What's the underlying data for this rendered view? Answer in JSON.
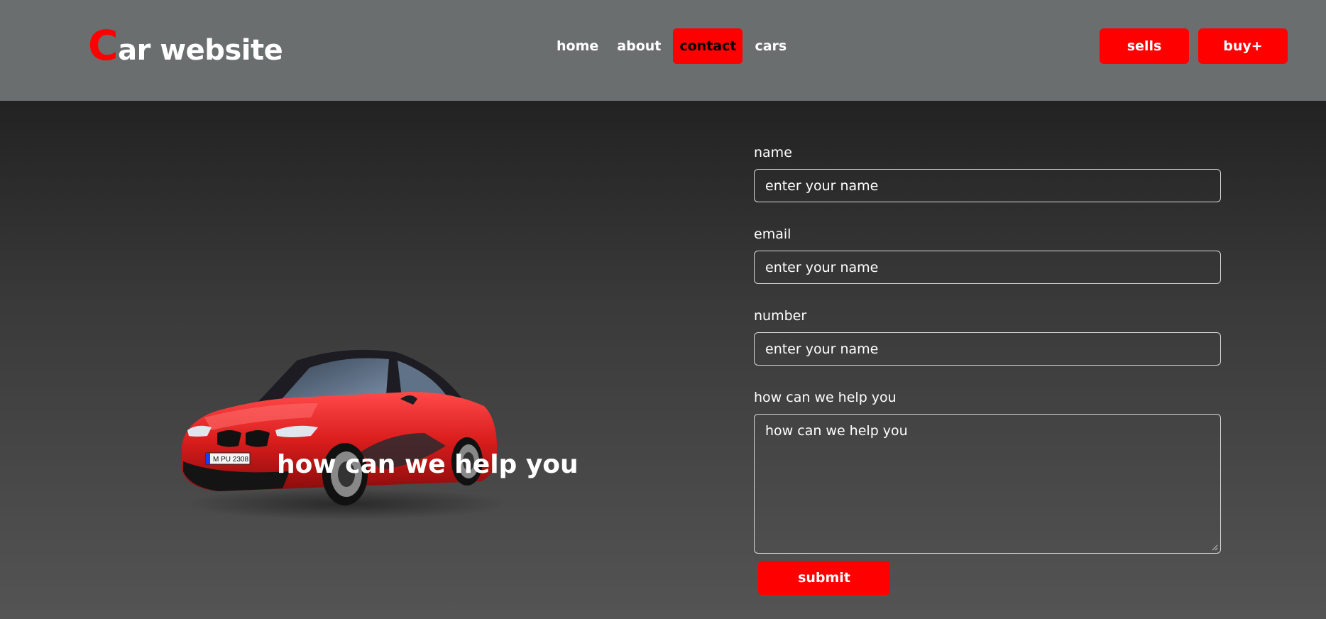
{
  "header": {
    "logo_initial": "C",
    "logo_rest": "ar website",
    "nav": [
      {
        "label": "home",
        "active": false
      },
      {
        "label": "about",
        "active": false
      },
      {
        "label": "contact",
        "active": true
      },
      {
        "label": "cars",
        "active": false
      }
    ],
    "sells_label": "sells",
    "buy_label": "buy+"
  },
  "main": {
    "car_image": "red-sports-car",
    "plate_text": "M PU 2308",
    "heading": "how can we help you"
  },
  "form": {
    "name_label": "name",
    "name_value": "enter your name",
    "email_label": "email",
    "email_value": "enter your name",
    "number_label": "number",
    "number_value": "enter your name",
    "help_label": "how can we help you",
    "help_value": "how can we help you",
    "submit_label": "submit"
  },
  "colors": {
    "accent": "#ff0000",
    "header_bg": "#6a6e6e",
    "text": "#ffffff"
  }
}
